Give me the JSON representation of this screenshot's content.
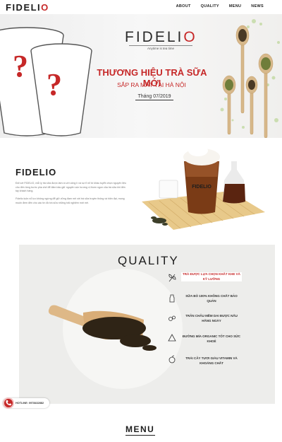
{
  "nav": {
    "logo": "FIDELI",
    "logo_mark": "O",
    "links": [
      "ABOUT",
      "QUALITY",
      "MENU",
      "NEWS"
    ]
  },
  "hero": {
    "brand": "FIDELI",
    "brand_mark": "O",
    "tagline": "Anytime is tea time",
    "title": "THƯƠNG HIỆU TRÀ SỮA MỚI",
    "subtitle": "SẮP RA MẮT TẠI HÀ NỘI",
    "date": "Tháng 07/2019",
    "cup_mark": "?"
  },
  "about": {
    "title": "FIDELIO",
    "para1": "Đối với FIDELIO, mỗi ly trà sữa được làm ra với công lì và sự tỉ mỉ từ khâu tuyển chọn nguyên liệu cho đến từng bước pha chế để đảm bảo giữ nguyên vẹn hương vị thơm ngon của trà sữa khi đến tay khách hàng.",
    "para2": "Fidelio luôn nỗ lực không ngừng để giữ vững đam mê với trà sữa truyền thống và hiện đại, mong muốn đem đến cho các tín đồ trà sữa những trải nghiệm mới mẻ.",
    "cup_brand": "FIDELIO"
  },
  "quality": {
    "title": "QUALITY",
    "items": [
      "TRÀ ĐƯỢC LỰA CHỌN KHẮT KHE VÀ KỸ LƯỠNG",
      "SỮA BÒ 100% KHÔNG CHẤT BẢO QUẢN",
      "TRÂN CHÂU MỀM DAI ĐƯỢC NẤU HẰNG NGÀY",
      "ĐƯỜNG MÍA ORGANIC TỐT CHO SỨC KHOẺ",
      "TRÁI CÂY TƯƠI GIÀU VITAMIN VÀ KHOÁNG CHẤT"
    ]
  },
  "hotline": {
    "text": "HOTLINE: 0978432882"
  },
  "menu": {
    "title": "MENU"
  },
  "colors": {
    "accent": "#c62828",
    "dark": "#1d1d1d",
    "section_bg": "#ededeb"
  }
}
